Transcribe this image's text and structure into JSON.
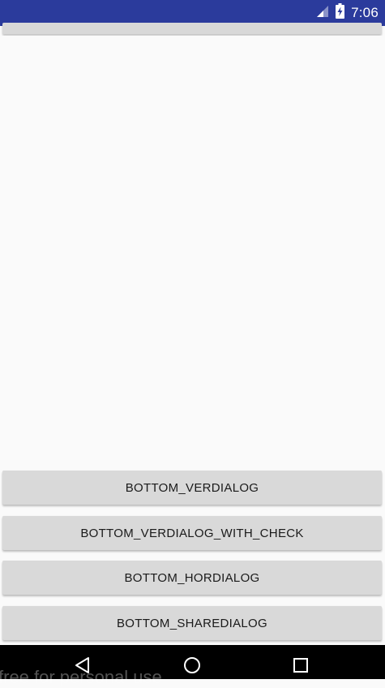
{
  "status_bar": {
    "time": "7:06",
    "background": "#2b3b9c",
    "icons": [
      "signal-icon",
      "battery-charging-icon"
    ]
  },
  "buttons": [
    {
      "label": "BOTTOM_VERDIALOG"
    },
    {
      "label": "BOTTOM_VERDIALOG_WITH_CHECK"
    },
    {
      "label": "BOTTOM_HORDIALOG"
    },
    {
      "label": "BOTTOM_SHAREDIALOG"
    }
  ],
  "nav_bar": {
    "icons": [
      "back-icon",
      "home-icon",
      "recents-icon"
    ]
  },
  "watermark": "free for personal use"
}
